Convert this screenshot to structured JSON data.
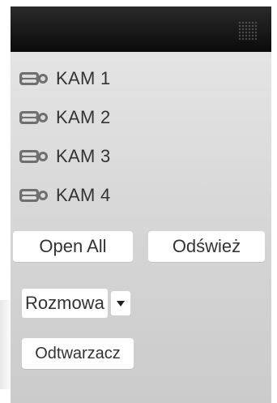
{
  "cameras": [
    {
      "label": "KAM 1",
      "icon": "camera-icon"
    },
    {
      "label": "KAM 2",
      "icon": "camera-icon"
    },
    {
      "label": "KAM 3",
      "icon": "camera-icon"
    },
    {
      "label": "KAM 4",
      "icon": "camera-icon"
    }
  ],
  "buttons": {
    "open_all": "Open All",
    "refresh": "Odśwież",
    "player": "Odtwarzacz"
  },
  "dropdown": {
    "selected": "Rozmowa",
    "arrow_icon": "triangle-down-icon"
  },
  "colors": {
    "header": "#111111",
    "panel": "#d8d8d8",
    "button_bg": "#ffffff",
    "text": "#333333"
  }
}
